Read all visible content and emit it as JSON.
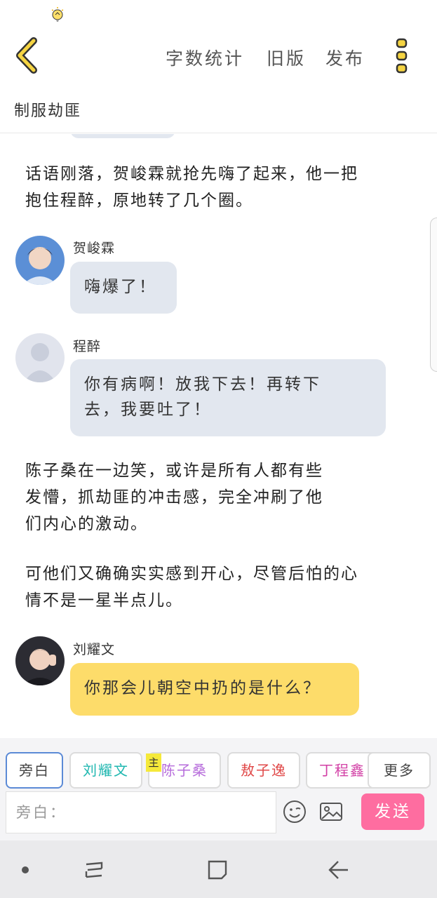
{
  "status_bar": {
    "icon": "lightbulb-icon"
  },
  "header": {
    "back_icon": "chevron-left-icon",
    "word_count": "字数统计",
    "old_version": "旧版",
    "publish": "发布",
    "more_icon": "vertical-dots-icon"
  },
  "title": "制服劫匪",
  "chat": {
    "narration1": [
      "话语刚落，贺峻霖就抢先嗨了起来，他一把",
      "抱住程醉，原地转了几个圈。"
    ],
    "msg1": {
      "speaker": "贺峻霖",
      "text": "嗨爆了！"
    },
    "msg2": {
      "speaker": "程醉",
      "lines": [
        "你有病啊！放我下去！再转下",
        "去，我要吐了！"
      ]
    },
    "narration2": [
      "陈子桑在一边笑，或许是所有人都有些",
      "发懵，抓劫匪的冲击感，完全冲刷了他",
      "们内心的激动。"
    ],
    "narration3": [
      "可他们又确确实实感到开心，尽管后怕的心",
      "情不是一星半点儿。"
    ],
    "msg3": {
      "speaker": "刘耀文",
      "text": "你那会儿朝空中扔的是什么？"
    }
  },
  "roles": {
    "narration": "旁白",
    "liuyaowen": "刘耀文",
    "chenzisang": "陈子桑",
    "main_badge": "主",
    "aozixia": "敖子逸",
    "dingchengxin": "丁程鑫",
    "more": "更多"
  },
  "input": {
    "placeholder": "旁白：",
    "send": "发送"
  },
  "colors": {
    "bubble_gray": "#e2e7ef",
    "bubble_yellow": "#fddc6a",
    "send_pink": "#fe6da0",
    "accent_yellow": "#f5d442"
  }
}
